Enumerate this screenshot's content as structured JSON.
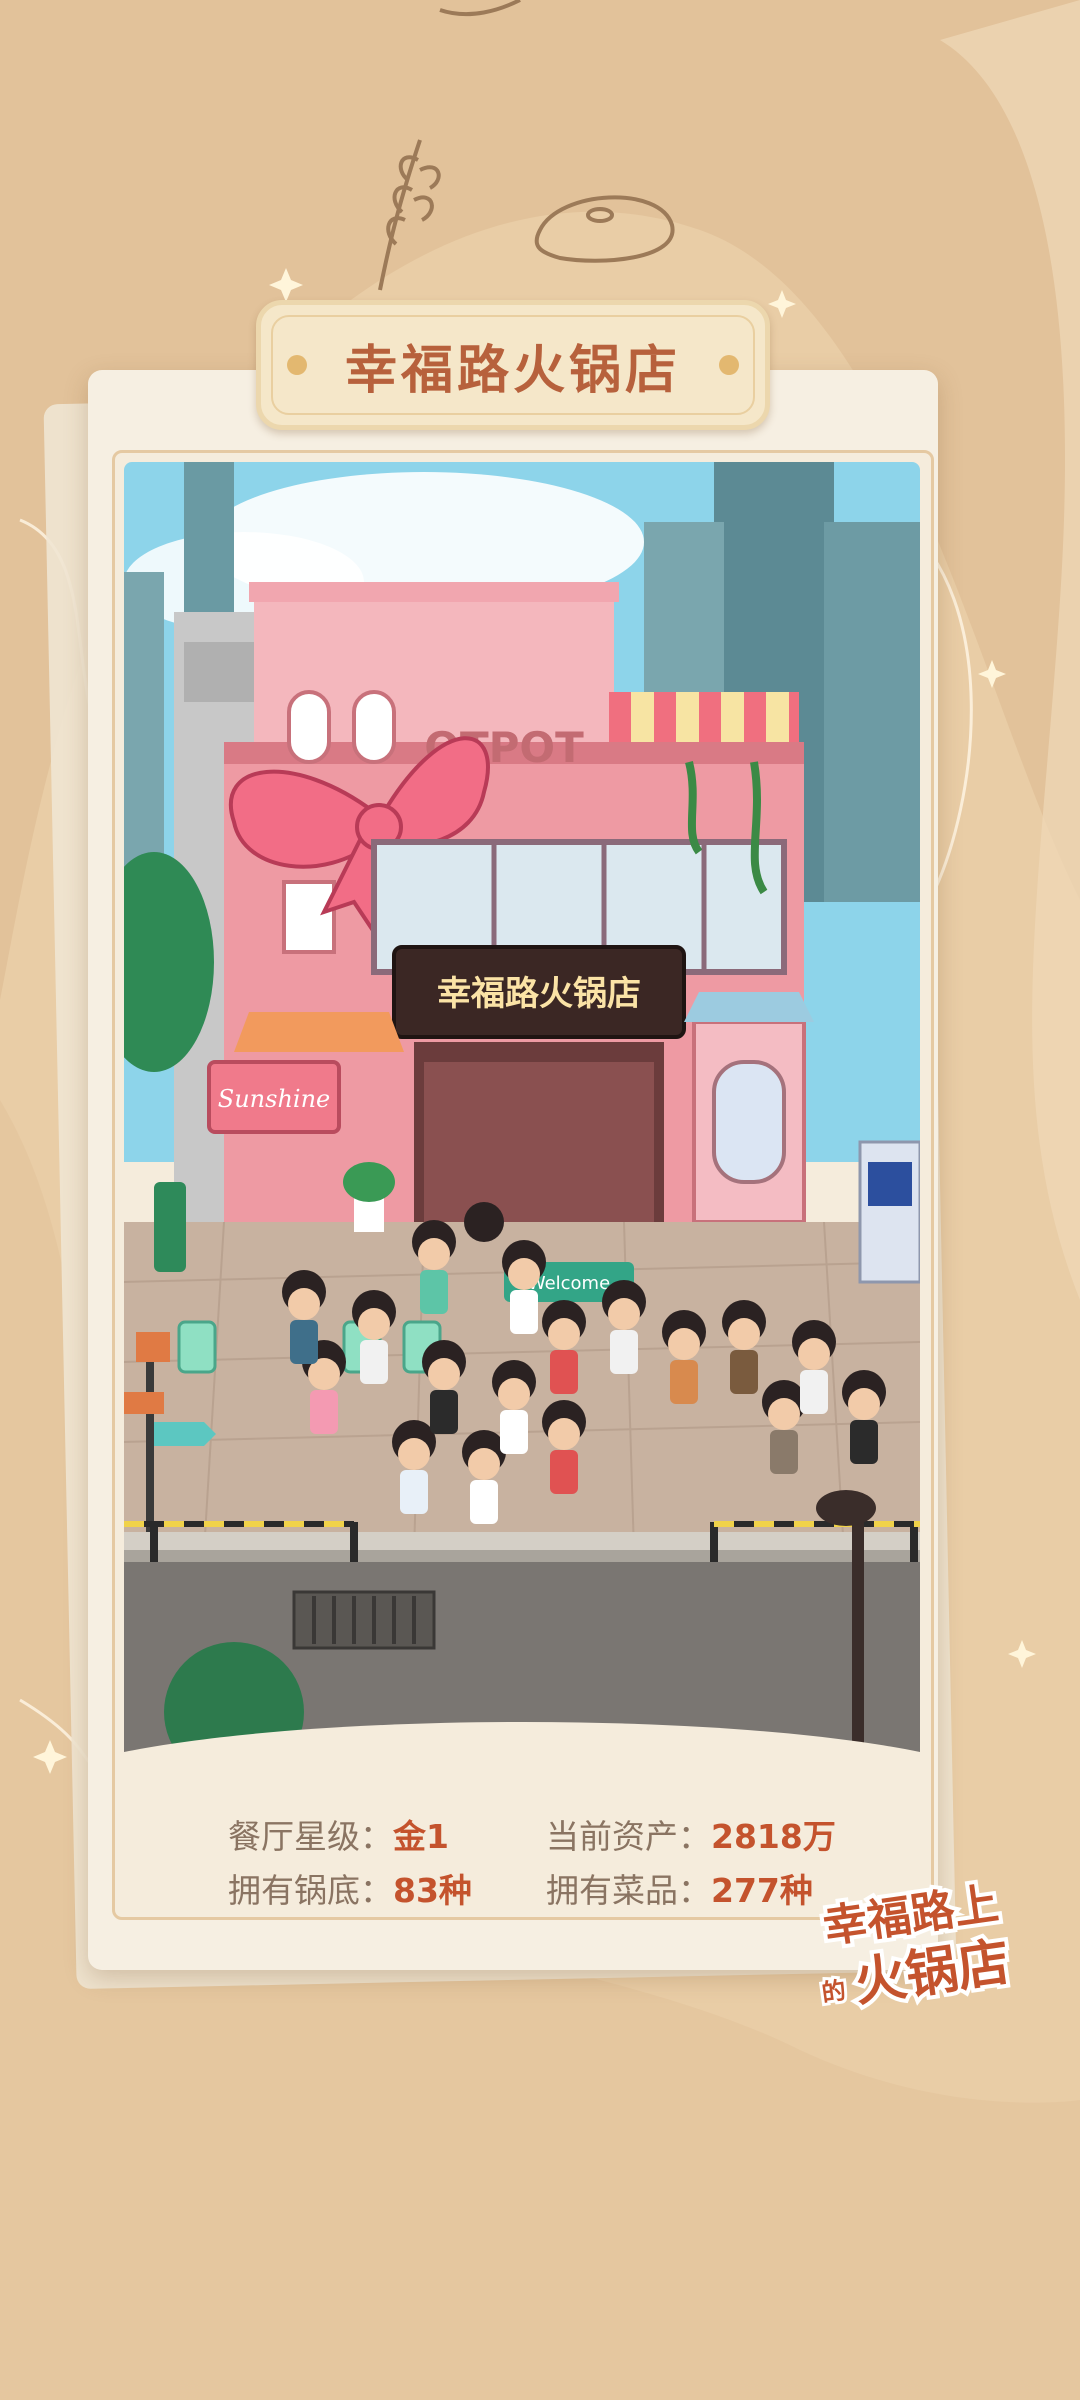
{
  "title": "幸福路火锅店",
  "scene": {
    "shop_sign": "幸福路火锅店",
    "facade_text": "OTPOT",
    "cafe_sign": "Sunshine",
    "table_sign": "Welcome"
  },
  "stats": [
    {
      "label": "餐厅星级",
      "value": "金1"
    },
    {
      "label": "当前资产",
      "value": "2818万"
    },
    {
      "label": "拥有锅底",
      "value": "83种"
    },
    {
      "label": "拥有菜品",
      "value": "277种"
    }
  ],
  "logo": {
    "line1": "幸福路上",
    "small": "的",
    "line2": "火锅店"
  },
  "colors": {
    "background": "#e6c79f",
    "accent": "#c4532d",
    "title": "#b7613c",
    "shop_pink": "#ef9aa3"
  },
  "icons": [
    "sparkle-icon",
    "leaf-icon",
    "potato-icon"
  ]
}
